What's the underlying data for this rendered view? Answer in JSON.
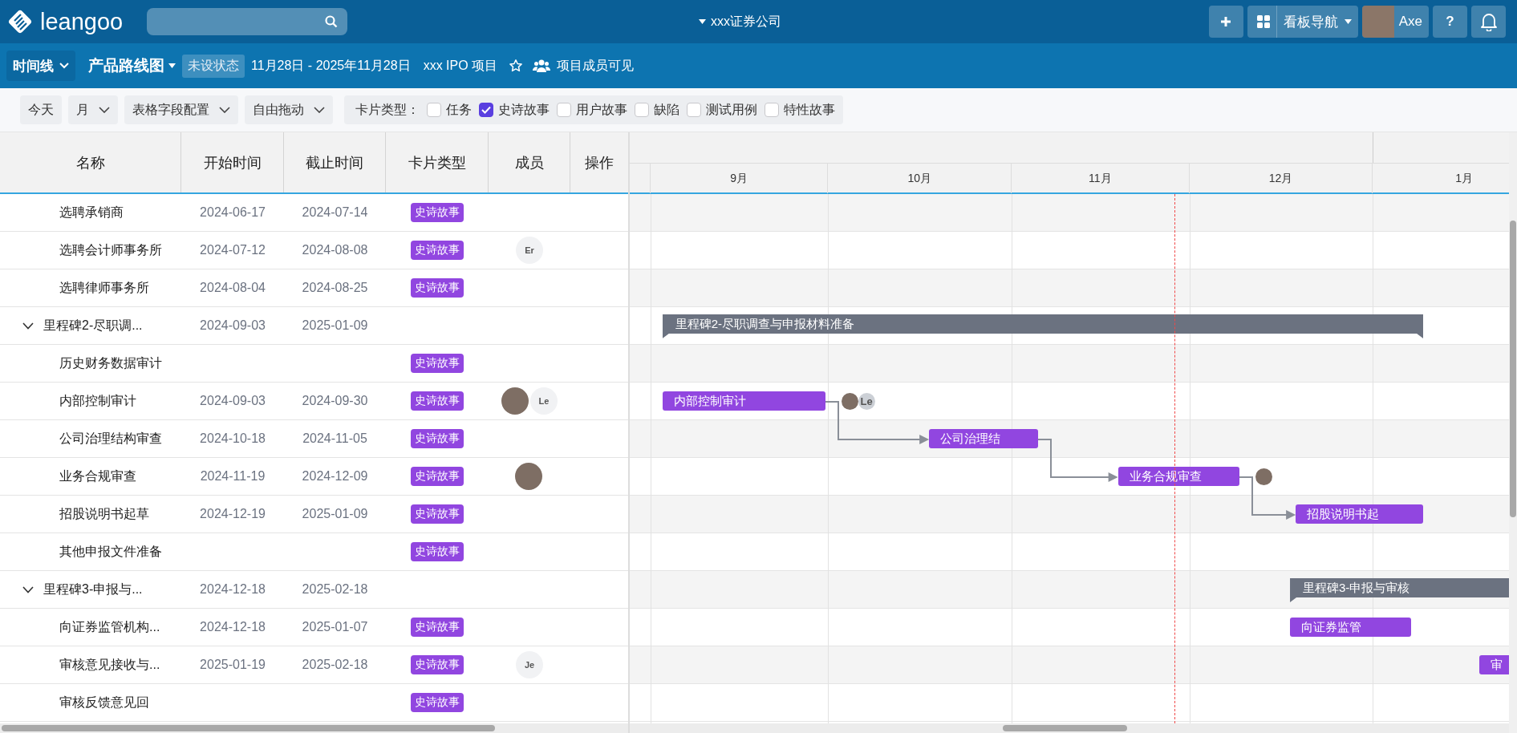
{
  "topbar": {
    "brand": "leangoo",
    "org": "xxx证券公司",
    "board_nav": "看板导航",
    "user": "Axe",
    "help": "?"
  },
  "project_bar": {
    "view": "时间线",
    "board": "产品路线图",
    "status": "未设状态",
    "date_range": "11月28日 - 2025年11月28日",
    "project": "xxx IPO 项目",
    "starred": false,
    "visibility": "项目成员可见"
  },
  "toolbar": {
    "buttons": [
      {
        "label": "今天",
        "kind": "plain"
      },
      {
        "label": "月",
        "kind": "dropdown"
      },
      {
        "label": "表格字段配置",
        "kind": "dropdown"
      },
      {
        "label": "自由拖动",
        "kind": "dropdown"
      }
    ],
    "filter_label": "卡片类型：",
    "filters": [
      {
        "label": "任务",
        "checked": false
      },
      {
        "label": "史诗故事",
        "checked": true
      },
      {
        "label": "用户故事",
        "checked": false
      },
      {
        "label": "缺陷",
        "checked": false
      },
      {
        "label": "测试用例",
        "checked": false
      },
      {
        "label": "特性故事",
        "checked": false
      }
    ]
  },
  "table": {
    "columns": [
      "名称",
      "开始时间",
      "截止时间",
      "卡片类型",
      "成员",
      "操作"
    ],
    "groups": [
      {
        "children": [
          {
            "name": "选聘承销商",
            "start": "2024-06-17",
            "end": "2024-07-14",
            "type": "史诗故事"
          },
          {
            "name": "选聘会计师事务所",
            "start": "2024-07-12",
            "end": "2024-08-08",
            "type": "史诗故事",
            "members": [
              {
                "kind": "initials",
                "text": "Er"
              }
            ]
          },
          {
            "name": "选聘律师事务所",
            "start": "2024-08-04",
            "end": "2024-08-25",
            "type": "史诗故事"
          }
        ]
      },
      {
        "name": "里程碑2-尽职调...",
        "start": "2024-09-03",
        "end": "2025-01-09",
        "expanded": true,
        "bar": {
          "label": "里程碑2-尽职调查与申报材料准备"
        },
        "children": [
          {
            "name": "历史财务数据审计",
            "type": "史诗故事"
          },
          {
            "name": "内部控制审计",
            "start": "2024-09-03",
            "end": "2024-09-30",
            "type": "史诗故事",
            "members": [
              {
                "kind": "photo"
              },
              {
                "kind": "initials",
                "text": "Le"
              }
            ],
            "bar": {
              "label": "内部控制审计",
              "linked": false,
              "members": [
                {
                  "kind": "photo"
                },
                {
                  "kind": "initials",
                  "text": "Le"
                }
              ]
            }
          },
          {
            "name": "公司治理结构审查",
            "start": "2024-10-18",
            "end": "2024-11-05",
            "type": "史诗故事",
            "bar": {
              "label": "公司治理结",
              "linked": true
            }
          },
          {
            "name": "业务合规审查",
            "start": "2024-11-19",
            "end": "2024-12-09",
            "type": "史诗故事",
            "members": [
              {
                "kind": "photo"
              }
            ],
            "bar": {
              "label": "业务合规审查",
              "linked": true,
              "members": [
                {
                  "kind": "photo"
                }
              ]
            }
          },
          {
            "name": "招股说明书起草",
            "start": "2024-12-19",
            "end": "2025-01-09",
            "type": "史诗故事",
            "bar": {
              "label": "招股说明书起",
              "linked": true
            }
          },
          {
            "name": "其他申报文件准备",
            "type": "史诗故事"
          }
        ]
      },
      {
        "name": "里程碑3-申报与...",
        "start": "2024-12-18",
        "end": "2025-02-18",
        "expanded": true,
        "bar": {
          "label": "里程碑3-申报与审核"
        },
        "children": [
          {
            "name": "向证券监管机构...",
            "start": "2024-12-18",
            "end": "2025-01-07",
            "type": "史诗故事",
            "bar": {
              "label": "向证券监管",
              "linked": false
            }
          },
          {
            "name": "审核意见接收与...",
            "start": "2025-01-19",
            "end": "2025-02-18",
            "type": "史诗故事",
            "members": [
              {
                "kind": "initials",
                "text": "Je"
              }
            ],
            "bar": {
              "label": "审",
              "linked": false
            }
          },
          {
            "name": "审核反馈意见回",
            "type": "史诗故事"
          }
        ]
      }
    ]
  },
  "gantt": {
    "months": [
      "9月",
      "10月",
      "11月",
      "12月",
      "1月"
    ],
    "today_line": true
  }
}
